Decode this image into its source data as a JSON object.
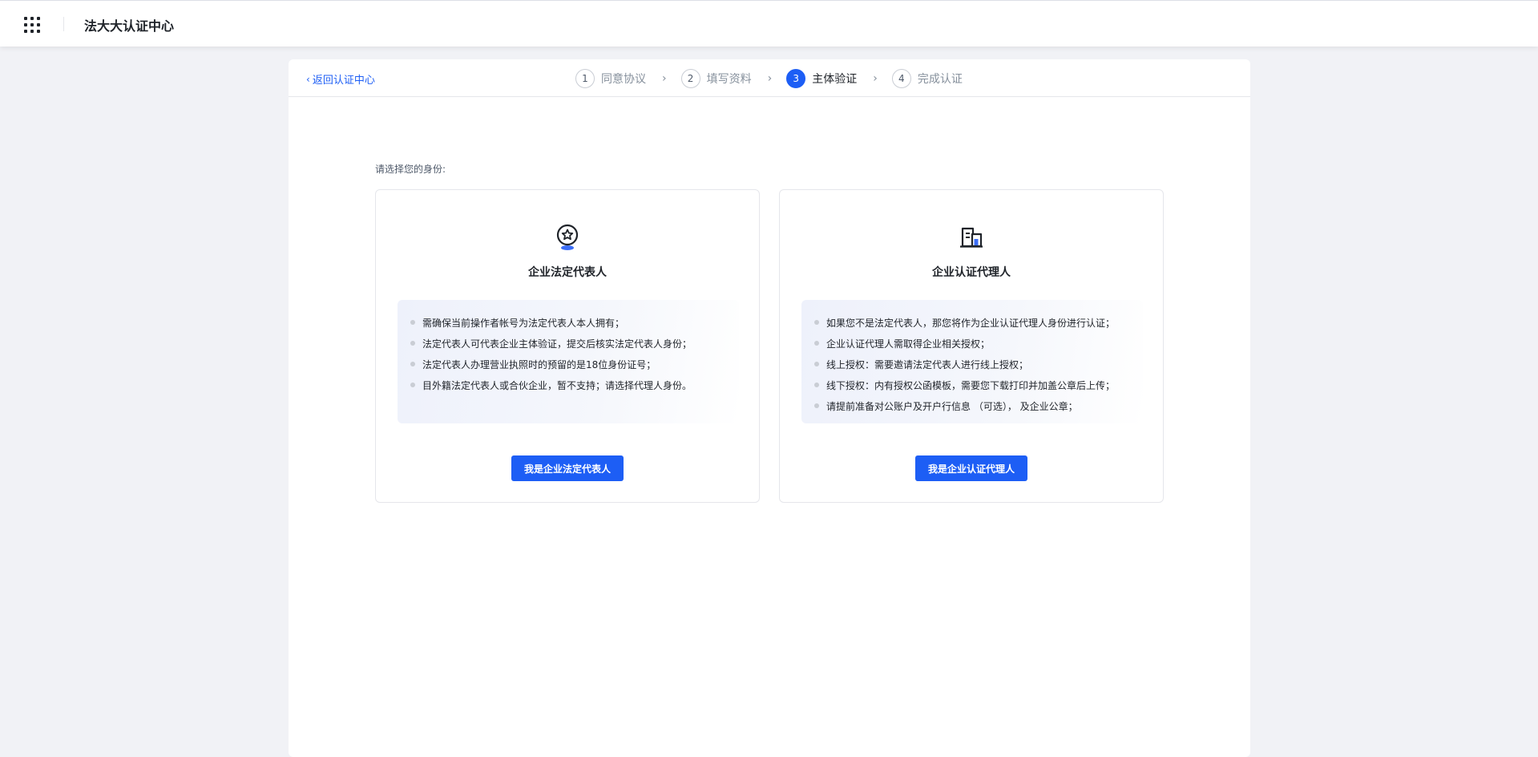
{
  "header": {
    "title": "法大大认证中心"
  },
  "stepbar": {
    "back_label": "返回认证中心",
    "steps": [
      {
        "num": "1",
        "label": "同意协议"
      },
      {
        "num": "2",
        "label": "填写资料"
      },
      {
        "num": "3",
        "label": "主体验证"
      },
      {
        "num": "4",
        "label": "完成认证"
      }
    ],
    "active_step": 3
  },
  "main": {
    "prompt": "请选择您的身份:",
    "cards": [
      {
        "icon": "badge-star-icon",
        "title": "企业法定代表人",
        "items": [
          "需确保当前操作者帐号为法定代表人本人拥有；",
          "法定代表人可代表企业主体验证，提交后核实法定代表人身份；",
          "法定代表人办理营业执照时的预留的是18位身份证号；",
          "目外籍法定代表人或合伙企业，暂不支持；请选择代理人身份。"
        ],
        "button": "我是企业法定代表人"
      },
      {
        "icon": "building-icon",
        "title": "企业认证代理人",
        "items": [
          "如果您不是法定代表人，那您将作为企业认证代理人身份进行认证；",
          "企业认证代理人需取得企业相关授权；",
          "线上授权：需要邀请法定代表人进行线上授权；",
          "线下授权：内有授权公函模板，需要您下载打印并加盖公章后上传；",
          "请提前准备对公账户及开户行信息 （可选）， 及企业公章；"
        ],
        "button": "我是企业认证代理人"
      }
    ]
  },
  "colors": {
    "primary": "#1d5ef5",
    "background": "#f1f2f6"
  }
}
